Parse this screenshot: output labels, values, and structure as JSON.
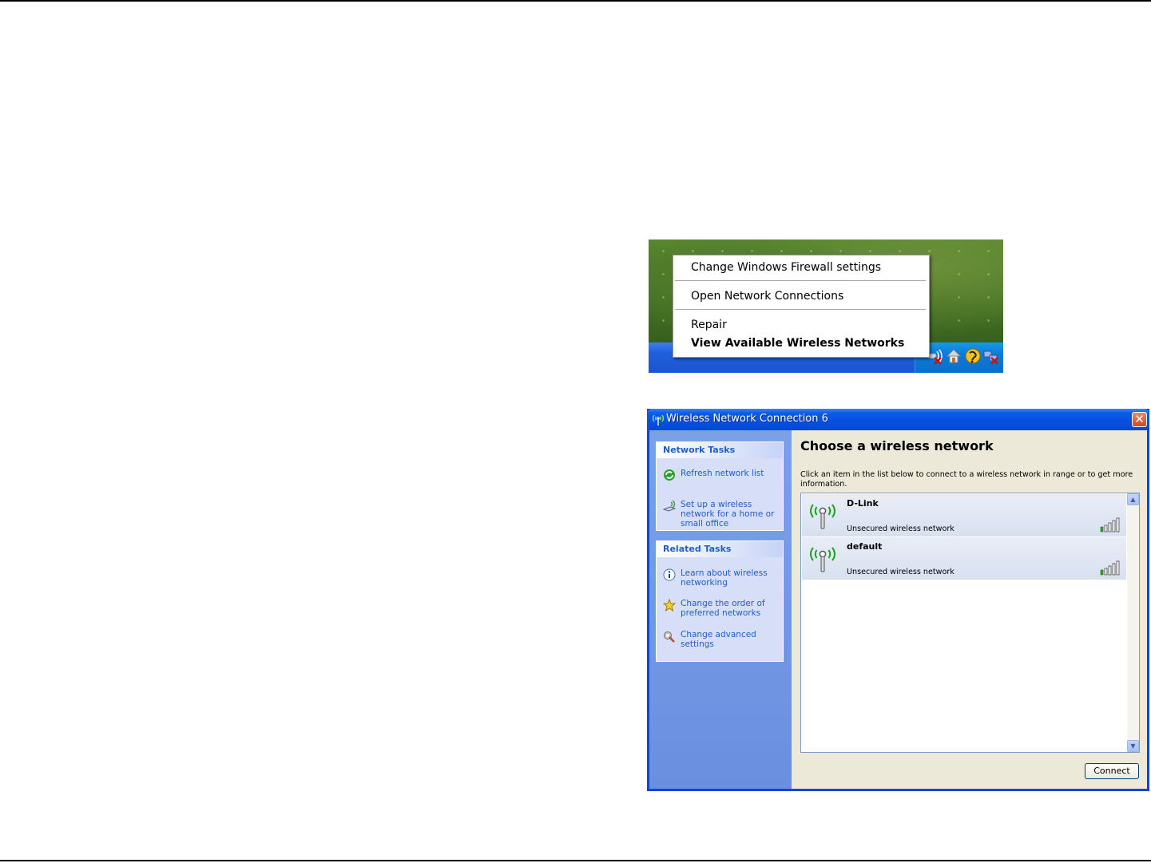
{
  "context_menu": {
    "items": [
      {
        "label": "Change Windows Firewall settings",
        "bold": false
      },
      {
        "label": "Open Network Connections",
        "bold": false
      },
      {
        "label": "Repair",
        "bold": false
      },
      {
        "label": "View Available Wireless Networks",
        "bold": true
      }
    ]
  },
  "tray_icons": [
    "wireless-disconnected-icon",
    "home-icon",
    "support-icon",
    "network-disconnected-icon"
  ],
  "dialog": {
    "title": "Wireless Network Connection 6",
    "close_label": "✕",
    "network_tasks": {
      "header": "Network Tasks",
      "items": [
        {
          "icon": "refresh-icon",
          "label": "Refresh network list"
        },
        {
          "icon": "setup-wireless-icon",
          "label": "Set up a wireless network for a home or small office"
        }
      ]
    },
    "related_tasks": {
      "header": "Related Tasks",
      "items": [
        {
          "icon": "info-icon",
          "label": "Learn about wireless networking"
        },
        {
          "icon": "star-icon",
          "label": "Change the order of preferred networks"
        },
        {
          "icon": "settings-icon",
          "label": "Change advanced settings"
        }
      ]
    },
    "heading": "Choose a wireless network",
    "description": "Click an item in the list below to connect to a wireless network in range or to get more information.",
    "networks": [
      {
        "name": "D-Link",
        "status": "Unsecured wireless network",
        "signal_bars": 1
      },
      {
        "name": "default",
        "status": "Unsecured wireless network",
        "signal_bars": 1
      }
    ],
    "connect_label": "Connect"
  }
}
